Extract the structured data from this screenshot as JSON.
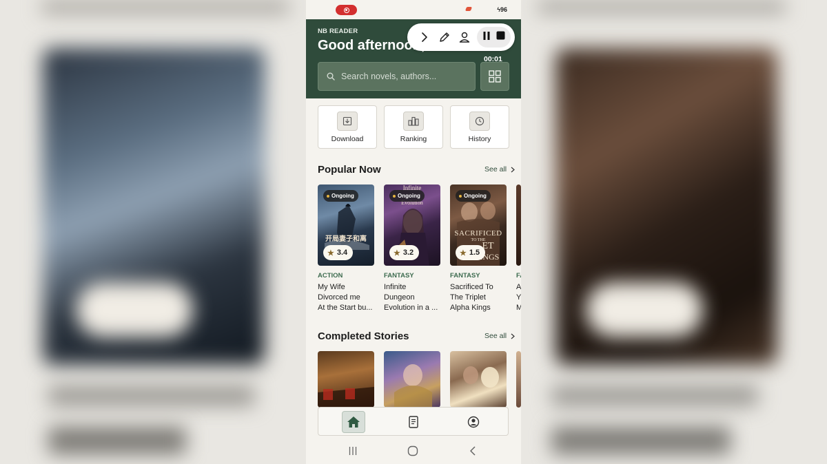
{
  "status_bar": {
    "battery": "96",
    "battery_icon": "bolt-icon"
  },
  "header": {
    "brand": "NB READER",
    "greeting": "Good afternoon,",
    "search_placeholder": "Search novels, authors...",
    "color": "#2f4b3b"
  },
  "recorder": {
    "timer": "00:01",
    "icons": [
      "chevron-right-icon",
      "pencil-icon",
      "person-icon",
      "pause-icon",
      "stop-icon"
    ]
  },
  "quick_actions": [
    {
      "label": "Download",
      "icon": "download-icon"
    },
    {
      "label": "Ranking",
      "icon": "ranking-icon"
    },
    {
      "label": "History",
      "icon": "clock-icon"
    }
  ],
  "sections": {
    "popular": {
      "title": "Popular Now",
      "see_all": "See all"
    },
    "completed": {
      "title": "Completed Stories",
      "see_all": "See all"
    }
  },
  "popular_books": [
    {
      "status": "Ongoing",
      "rating": "3.4",
      "genre": "ACTION",
      "title_lines": [
        "My Wife",
        "Divorced me",
        "At the Start bu..."
      ]
    },
    {
      "status": "Ongoing",
      "rating": "3.2",
      "genre": "FANTASY",
      "title_lines": [
        "Infinite",
        "Dungeon",
        "Evolution in a ..."
      ]
    },
    {
      "status": "Ongoing",
      "rating": "1.5",
      "genre": "FANTASY",
      "title_lines": [
        "Sacrificed To",
        "The Triplet",
        "Alpha Kings"
      ]
    },
    {
      "genre": "FA",
      "title_lines": [
        "A",
        "Y",
        "M"
      ]
    }
  ],
  "cover_art_text": {
    "book1": "开局妻子和离",
    "book2_top": "Infinite",
    "book2_mid": "Evolution",
    "book3_a": "SACRIFICED",
    "book3_b": "TO THE",
    "book3_c": "ET",
    "book3_d": "KINGS"
  },
  "bottom_nav": [
    {
      "icon": "home-icon",
      "active": true
    },
    {
      "icon": "book-icon",
      "active": false
    },
    {
      "icon": "profile-icon",
      "active": false
    }
  ],
  "system_nav": [
    "recents-icon",
    "home-circle-icon",
    "back-icon"
  ]
}
